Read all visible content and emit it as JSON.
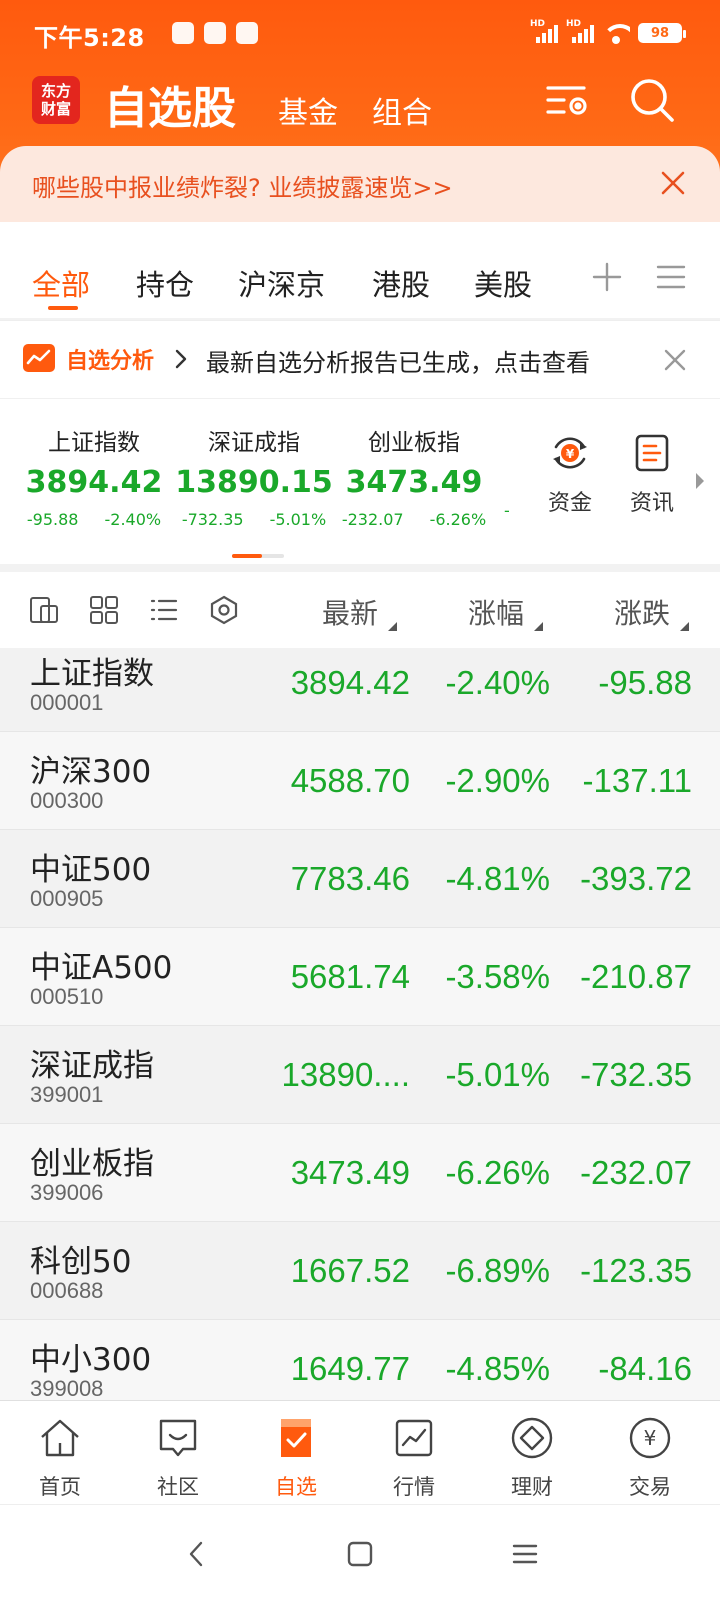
{
  "status_bar": {
    "time": "下午5:28",
    "battery": "98",
    "network_1": "HD",
    "network_2": "HD"
  },
  "header": {
    "logo_text": "东方财富",
    "title": "自选股",
    "fund_label": "基金",
    "combo_label": "组合",
    "accent_color": "#ff5a0e"
  },
  "banner": {
    "text": "哪些股中报业绩炸裂? 业绩披露速览>>"
  },
  "tabs": [
    {
      "label": "全部",
      "active": true
    },
    {
      "label": "持仓",
      "active": false
    },
    {
      "label": "沪深京",
      "active": false
    },
    {
      "label": "港股",
      "active": false
    },
    {
      "label": "美股",
      "active": false
    }
  ],
  "analysis": {
    "label": "自选分析",
    "text": "最新自选分析报告已生成，点击查看"
  },
  "indices": [
    {
      "name": "上证指数",
      "value": "3894.42",
      "change": "-95.88",
      "pct": "-2.40%"
    },
    {
      "name": "深证成指",
      "value": "13890.15",
      "change": "-732.35",
      "pct": "-5.01%"
    },
    {
      "name": "创业板指",
      "value": "3473.49",
      "change": "-232.07",
      "pct": "-6.26%"
    }
  ],
  "index_trailing": "-",
  "quick_links": [
    {
      "label": "资金",
      "icon": "capital-flow-icon"
    },
    {
      "label": "资讯",
      "icon": "news-icon"
    }
  ],
  "columns": {
    "last": "最新",
    "pct": "涨幅",
    "chg": "涨跌"
  },
  "rows": [
    {
      "name": "上证指数",
      "code": "000001",
      "last": "3894.42",
      "pct": "-2.40%",
      "chg": "-95.88"
    },
    {
      "name": "沪深300",
      "code": "000300",
      "last": "4588.70",
      "pct": "-2.90%",
      "chg": "-137.11"
    },
    {
      "name": "中证500",
      "code": "000905",
      "last": "7783.46",
      "pct": "-4.81%",
      "chg": "-393.72"
    },
    {
      "name": "中证A500",
      "code": "000510",
      "last": "5681.74",
      "pct": "-3.58%",
      "chg": "-210.87"
    },
    {
      "name": "深证成指",
      "code": "399001",
      "last": "13890....",
      "pct": "-5.01%",
      "chg": "-732.35"
    },
    {
      "name": "创业板指",
      "code": "399006",
      "last": "3473.49",
      "pct": "-6.26%",
      "chg": "-232.07"
    },
    {
      "name": "科创50",
      "code": "000688",
      "last": "1667.52",
      "pct": "-6.89%",
      "chg": "-123.35"
    },
    {
      "name": "中小300",
      "code": "399008",
      "last": "1649.77",
      "pct": "-4.85%",
      "chg": "-84.16"
    }
  ],
  "bottom_nav": [
    {
      "label": "首页",
      "icon": "home-icon",
      "active": false
    },
    {
      "label": "社区",
      "icon": "community-icon",
      "active": false
    },
    {
      "label": "自选",
      "icon": "watchlist-icon",
      "active": true
    },
    {
      "label": "行情",
      "icon": "market-icon",
      "active": false
    },
    {
      "label": "理财",
      "icon": "wealth-icon",
      "active": false
    },
    {
      "label": "交易",
      "icon": "trade-icon",
      "active": false
    }
  ],
  "colors": {
    "down": "#1aa82a",
    "accent": "#ff5a0e",
    "banner_bg": "#fde8de",
    "banner_text": "#e8501f"
  }
}
